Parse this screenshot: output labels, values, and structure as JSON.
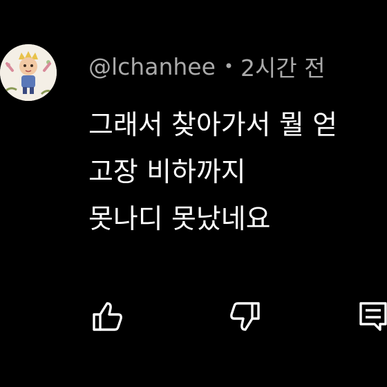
{
  "comment": {
    "username": "@lchanhee",
    "separator": "•",
    "time_ago": "2시간 전",
    "lines": [
      "그래서 찾아가서 뭘 얻",
      "고장 비하까지",
      "못나디 못났네요"
    ]
  },
  "icons": {
    "avatar": "avatar-image",
    "like": "thumbs-up-icon",
    "dislike": "thumbs-down-icon",
    "reply": "reply-icon"
  },
  "colors": {
    "background": "#000000",
    "text": "#ffffff",
    "meta_text": "#aaaaaa"
  }
}
